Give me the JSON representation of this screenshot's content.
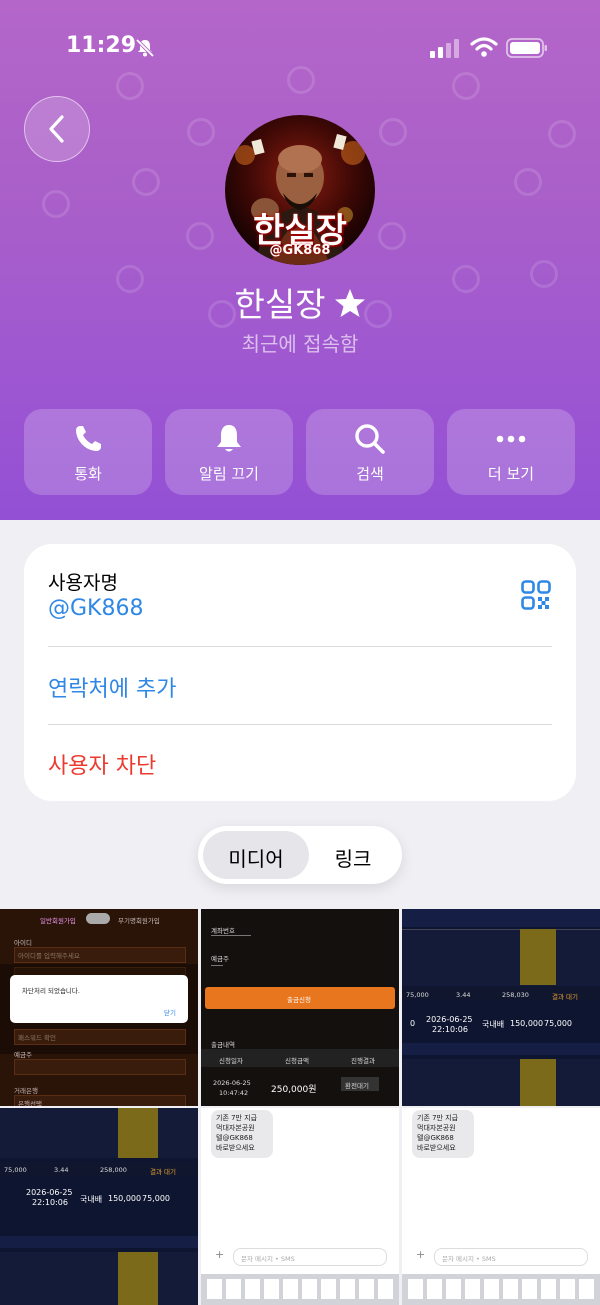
{
  "status_bar": {
    "time": "11:29"
  },
  "profile": {
    "name": "한실장",
    "last_seen": "최근에 접속함",
    "avatar_art_name": "한실장",
    "avatar_art_handle": "@GK868"
  },
  "actions": [
    {
      "label": "통화",
      "icon": "phone-icon"
    },
    {
      "label": "알림 끄기",
      "icon": "bell-icon"
    },
    {
      "label": "검색",
      "icon": "search-icon"
    },
    {
      "label": "더 보기",
      "icon": "more-icon"
    }
  ],
  "info_card": {
    "username_label": "사용자명",
    "username": "@GK868",
    "add_contact": "연락처에 추가",
    "block_user": "사용자 차단"
  },
  "segments": {
    "media": "미디어",
    "link": "링크",
    "selected": "미디어"
  },
  "media_thumbs": {
    "t1": {
      "toggle_a": "일반회원가입",
      "toggle_b": "무기명회원가입",
      "field1": "아이디",
      "hint1": "아이디를 입력해주세요",
      "dialog_text": "차단처리 되었습니다.",
      "dialog_btn": "닫기",
      "pw_hint": "패스워드 확인",
      "field_deposit": "예금주",
      "bank_label": "거래은행",
      "bank_select": "은행선택"
    },
    "t2": {
      "acct": "계좌번호",
      "holder": "예금주",
      "btn": "출금신청",
      "history": "출금내역",
      "col1": "신청일자",
      "col2": "신청금액",
      "col3": "진행결과",
      "date": "2026-06-25",
      "time": "10:47:42",
      "amount": "250,000원",
      "status": "환전대기"
    },
    "t3": {
      "date": "2026-06-25",
      "time": "22:10:06",
      "amount": "75,000",
      "rate": "3.44",
      "expected": "258,030",
      "status": "결과 대기",
      "league": "국내배",
      "stake": "150,000",
      "stake2": "75,000",
      "bet_count": "0"
    },
    "t4": {
      "date": "2026-06-25",
      "time": "22:10:06",
      "amount": "75,000",
      "rate": "3.44",
      "expected": "258,000",
      "status": "결과 대기",
      "league": "국내배",
      "stake": "150,000",
      "stake2": "75,000"
    },
    "t5": {
      "msg_line1": "기존 7만 지급",
      "msg_line2": "먹대자본공원",
      "msg_line3": "텔@GK868",
      "msg_line4": "바로받으세요",
      "input_hint": "문자 메시지 • SMS"
    },
    "t6": {
      "msg_line1": "기존 7만 지급",
      "msg_line2": "먹대자본공원",
      "msg_line3": "텔@GK868",
      "msg_line4": "바로받으세요",
      "input_hint": "문자 메시지 • SMS"
    }
  },
  "colors": {
    "header_top": "#b466c9",
    "header_bottom": "#9350d4",
    "link_blue": "#2f87e6",
    "danger_red": "#ec3a2f",
    "withdraw_orange": "#e8761f"
  }
}
